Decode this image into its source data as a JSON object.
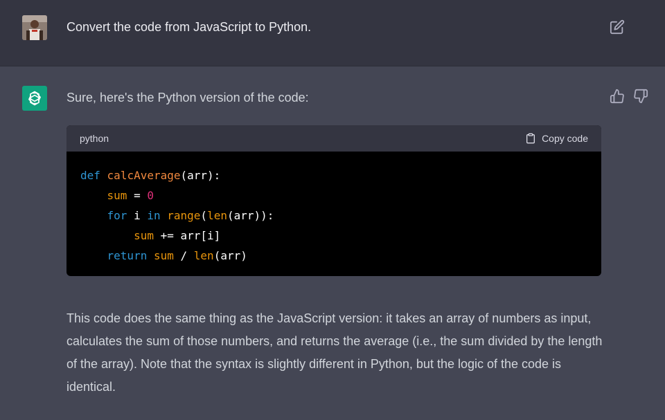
{
  "user_message": {
    "text": "Convert the code from JavaScript to Python."
  },
  "assistant_message": {
    "intro": "Sure, here's the Python version of the code:",
    "code_block": {
      "language": "python",
      "copy_label": "Copy code",
      "lines": [
        [
          {
            "t": "def",
            "c": "kw"
          },
          {
            "t": " ",
            "c": "p"
          },
          {
            "t": "calcAverage",
            "c": "func"
          },
          {
            "t": "(arr):",
            "c": "p"
          }
        ],
        [
          {
            "t": "    ",
            "c": "p"
          },
          {
            "t": "sum",
            "c": "var"
          },
          {
            "t": " = ",
            "c": "p"
          },
          {
            "t": "0",
            "c": "num"
          }
        ],
        [
          {
            "t": "    ",
            "c": "p"
          },
          {
            "t": "for",
            "c": "kw"
          },
          {
            "t": " i ",
            "c": "p"
          },
          {
            "t": "in",
            "c": "kw"
          },
          {
            "t": " ",
            "c": "p"
          },
          {
            "t": "range",
            "c": "builtin"
          },
          {
            "t": "(",
            "c": "p"
          },
          {
            "t": "len",
            "c": "builtin"
          },
          {
            "t": "(arr)):",
            "c": "p"
          }
        ],
        [
          {
            "t": "        ",
            "c": "p"
          },
          {
            "t": "sum",
            "c": "var"
          },
          {
            "t": " += arr[i]",
            "c": "p"
          }
        ],
        [
          {
            "t": "    ",
            "c": "p"
          },
          {
            "t": "return",
            "c": "kw"
          },
          {
            "t": " ",
            "c": "p"
          },
          {
            "t": "sum",
            "c": "var"
          },
          {
            "t": " / ",
            "c": "p"
          },
          {
            "t": "len",
            "c": "builtin"
          },
          {
            "t": "(arr)",
            "c": "p"
          }
        ]
      ]
    },
    "paragraph": "This code does the same thing as the JavaScript version: it takes an array of numbers as input, calculates the sum of those numbers, and returns the average (i.e., the sum divided by the length of the array). Note that the syntax is slightly different in Python, but the logic of the code is identical."
  },
  "icons": {
    "edit": "edit-icon",
    "copy": "clipboard-icon",
    "thumbs_up": "thumbs-up-icon",
    "thumbs_down": "thumbs-down-icon",
    "bot_logo": "openai-logo-icon"
  },
  "colors": {
    "user_bg": "#343541",
    "assistant_bg": "#444654",
    "bot_avatar": "#10a37f",
    "code_bg": "#000000",
    "code_header": "#343541"
  }
}
